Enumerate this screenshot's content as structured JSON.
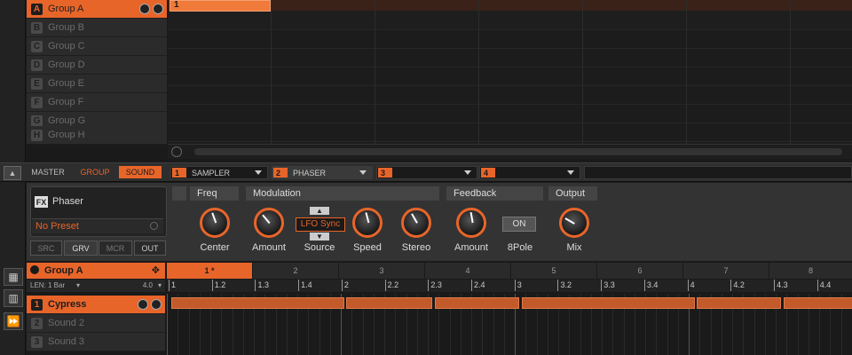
{
  "groups": {
    "items": [
      {
        "letter": "A",
        "label": "Group A",
        "active": true
      },
      {
        "letter": "B",
        "label": "Group B",
        "active": false
      },
      {
        "letter": "C",
        "label": "Group C",
        "active": false
      },
      {
        "letter": "D",
        "label": "Group D",
        "active": false
      },
      {
        "letter": "E",
        "label": "Group E",
        "active": false
      },
      {
        "letter": "F",
        "label": "Group F",
        "active": false
      },
      {
        "letter": "G",
        "label": "Group G",
        "active": false
      },
      {
        "letter": "H",
        "label": "Group H",
        "active": false
      }
    ]
  },
  "arranger": {
    "scene_label": "1"
  },
  "tabs": {
    "master": "MASTER",
    "group": "GROUP",
    "sound": "SOUND"
  },
  "slots": [
    {
      "num": "1",
      "name": "SAMPLER"
    },
    {
      "num": "2",
      "name": "PHASER"
    },
    {
      "num": "3",
      "name": ""
    },
    {
      "num": "4",
      "name": ""
    }
  ],
  "plugin": {
    "badge": "FX",
    "name": "Phaser",
    "preset": "No Preset",
    "buttons": [
      "SRC",
      "GRV",
      "MCR",
      "OUT"
    ],
    "sections": {
      "freq": "Freq",
      "modulation": "Modulation",
      "feedback": "Feedback",
      "output": "Output"
    },
    "knobs": [
      "Center",
      "Amount",
      "Source",
      "Speed",
      "Stereo",
      "Amount",
      "8Pole",
      "Mix"
    ],
    "source_value": "LFO Sync",
    "pole_button": "ON"
  },
  "pattern": {
    "group_name": "Group A",
    "len_label": "LEN: 1 Bar",
    "zoom": "4.0",
    "tabs": [
      "1 *",
      "2",
      "3",
      "4",
      "5",
      "6",
      "7",
      "8"
    ],
    "ruler": [
      "1",
      "1.2",
      "1.3",
      "1.4",
      "2",
      "2.2",
      "2.3",
      "2.4",
      "3",
      "3.2",
      "3.3",
      "3.4",
      "4",
      "4.2",
      "4.3",
      "4.4"
    ],
    "sounds": [
      {
        "num": "1",
        "name": "Cypress",
        "active": true
      },
      {
        "num": "2",
        "name": "Sound 2",
        "active": false
      },
      {
        "num": "3",
        "name": "Sound 3",
        "active": false
      }
    ]
  },
  "colors": {
    "accent": "#e8652a",
    "panel": "#333333",
    "background": "#1a1a1a"
  },
  "icons": {
    "collapse": "triangle-up-icon",
    "search": "magnifier-icon",
    "move": "move-arrows-icon",
    "dropdown": "chevron-down-icon"
  }
}
